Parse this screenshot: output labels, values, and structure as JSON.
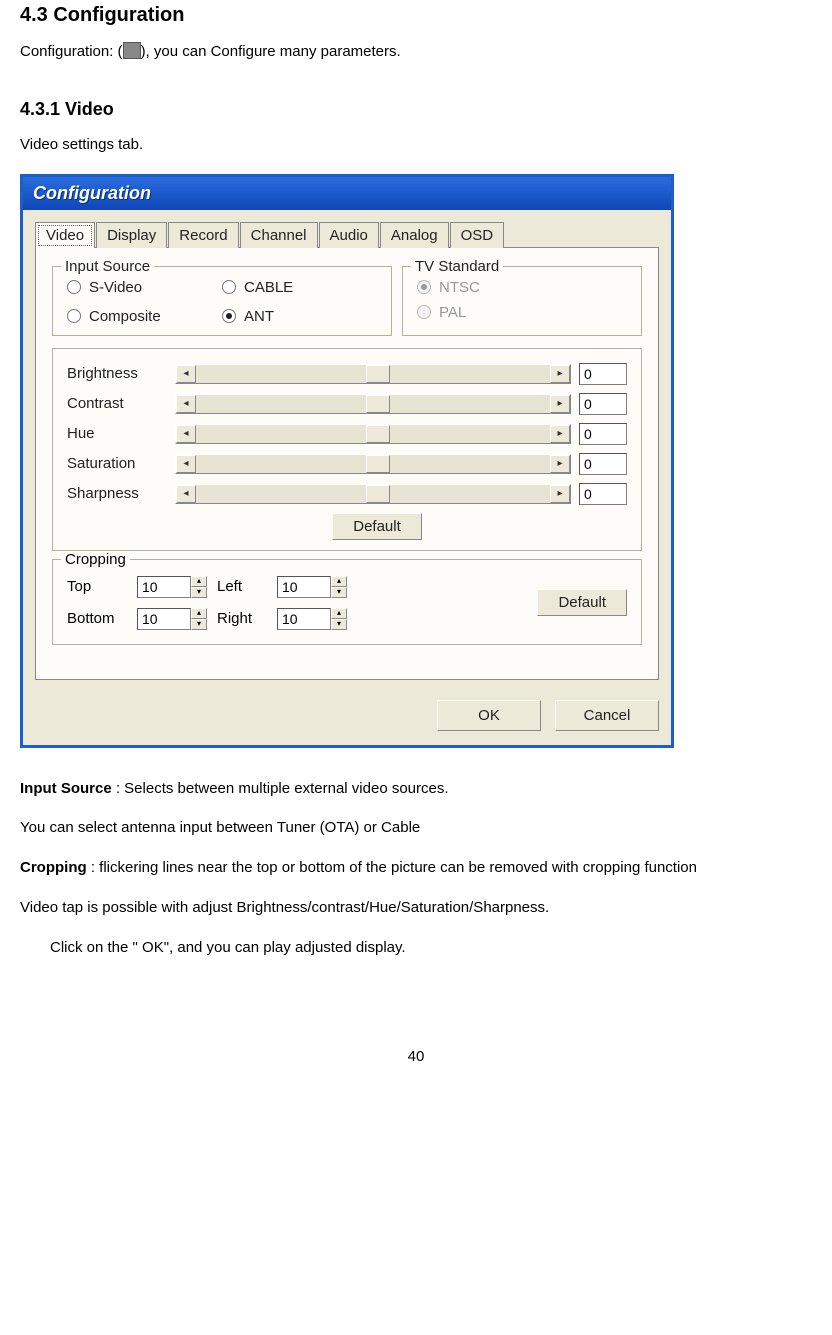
{
  "headings": {
    "h43": "4.3    Configuration",
    "h431": "4.3.1        Video"
  },
  "text": {
    "config_intro_a": "Configuration:   (",
    "config_intro_b": "), you can Configure many parameters.",
    "video_tab": "Video settings tab.",
    "input_source_lbl": "Input Source",
    "input_source_body": " : Selects between multiple external video sources.",
    "antenna_line": " You can select antenna input between Tuner (OTA) or Cable",
    "cropping_lbl": "Cropping",
    "cropping_body": " : flickering lines near the top or bottom of the picture can be removed with cropping function",
    "adjust_line": "Video tap is possible with adjust Brightness/contrast/Hue/Saturation/Sharpness.",
    "ok_line": "Click on the \" OK\", and you can play adjusted display.",
    "page_no": "40"
  },
  "dialog": {
    "title": "Configuration",
    "tabs": [
      "Video",
      "Display",
      "Record",
      "Channel",
      "Audio",
      "Analog",
      "OSD"
    ],
    "active_tab": "Video",
    "input_source": {
      "legend": "Input Source",
      "options": [
        "S-Video",
        "CABLE",
        "Composite",
        "ANT"
      ],
      "selected": "ANT"
    },
    "tv_standard": {
      "legend": "TV Standard",
      "options": [
        "NTSC",
        "PAL"
      ],
      "selected": "NTSC",
      "disabled": true
    },
    "sliders": [
      {
        "label": "Brightness",
        "value": "0"
      },
      {
        "label": "Contrast",
        "value": "0"
      },
      {
        "label": "Hue",
        "value": "0"
      },
      {
        "label": "Saturation",
        "value": "0"
      },
      {
        "label": "Sharpness",
        "value": "0"
      }
    ],
    "default_btn": "Default",
    "cropping": {
      "legend": "Cropping",
      "top_lbl": "Top",
      "top_val": "10",
      "bottom_lbl": "Bottom",
      "bottom_val": "10",
      "left_lbl": "Left",
      "left_val": "10",
      "right_lbl": "Right",
      "right_val": "10",
      "default_btn": "Default"
    },
    "ok": "OK",
    "cancel": "Cancel"
  }
}
